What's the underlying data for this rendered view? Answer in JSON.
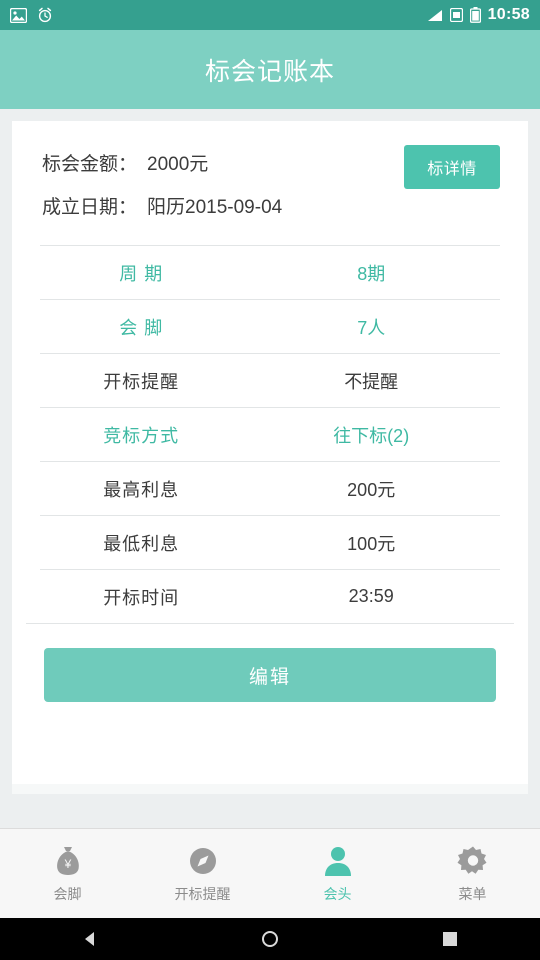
{
  "status_bar": {
    "time": "10:58",
    "left_icons": [
      "image-icon",
      "alarm-icon"
    ],
    "right_icons": [
      "signal-icon",
      "sim-card-icon",
      "battery-icon"
    ]
  },
  "header": {
    "title": "标会记账本"
  },
  "summary": {
    "amount_label": "标会金额：",
    "amount_value": "2000元",
    "date_label": "成立日期：",
    "date_value": "阳历2015-09-04",
    "detail_button": "标详情"
  },
  "rows": [
    {
      "key": "周   期",
      "value": "8期",
      "highlight": true
    },
    {
      "key": "会   脚",
      "value": "7人",
      "highlight": true
    },
    {
      "key": "开标提醒",
      "value": "不提醒",
      "highlight": false
    },
    {
      "key": "竞标方式",
      "value": "往下标(2)",
      "highlight": true
    },
    {
      "key": "最高利息",
      "value": "200元",
      "highlight": false
    },
    {
      "key": "最低利息",
      "value": "100元",
      "highlight": false
    },
    {
      "key": "开标时间",
      "value": "23:59",
      "highlight": false
    }
  ],
  "edit_button": "编辑",
  "tabs": [
    {
      "label": "会脚",
      "icon": "money-bag-icon",
      "active": false
    },
    {
      "label": "开标提醒",
      "icon": "compass-icon",
      "active": false
    },
    {
      "label": "会头",
      "icon": "person-icon",
      "active": true
    },
    {
      "label": "菜单",
      "icon": "gear-icon",
      "active": false
    }
  ],
  "nav_bar": {
    "back": "back-triangle-icon",
    "home": "home-circle-icon",
    "recents": "recents-square-icon"
  },
  "colors": {
    "status_bar": "#35a08f",
    "title_bar": "#7ed0c2",
    "accent": "#4dc3ae",
    "edit_button": "#6fcbbb"
  }
}
